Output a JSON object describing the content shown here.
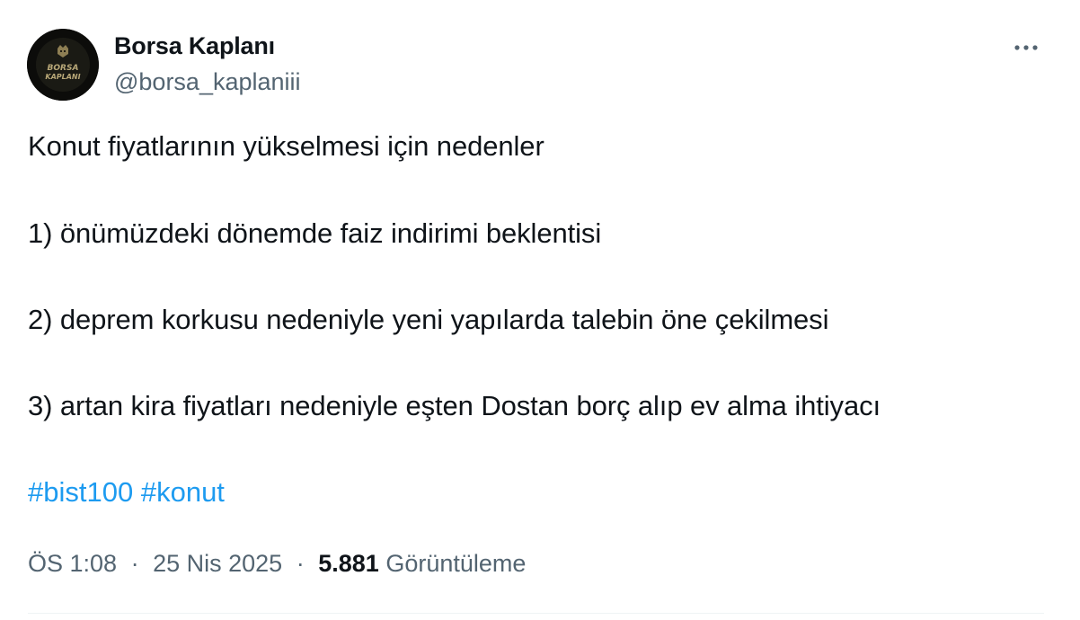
{
  "author": {
    "display_name": "Borsa Kaplanı",
    "handle": "@borsa_kaplaniii",
    "avatar_text_line1": "BORSA",
    "avatar_text_line2": "KAPLANI"
  },
  "tweet": {
    "lines": [
      "Konut fiyatlarının yükselmesi için nedenler",
      "1) önümüzdeki dönemde faiz indirimi beklentisi",
      "2) deprem korkusu nedeniyle yeni yapılarda talebin öne çekilmesi",
      "3) artan kira fiyatları nedeniyle eşten Dostan borç alıp ev alma ihtiyacı"
    ],
    "hashtags": [
      "#bist100",
      "#konut"
    ]
  },
  "meta": {
    "time": "ÖS 1:08",
    "separator": "·",
    "date": "25 Nis 2025",
    "views_count": "5.881",
    "views_label": "Görüntüleme"
  },
  "icons": {
    "more": "more-options-icon"
  },
  "colors": {
    "text": "#0f1419",
    "secondary": "#536471",
    "link": "#1d9bf0",
    "divider": "#eff3f4"
  }
}
